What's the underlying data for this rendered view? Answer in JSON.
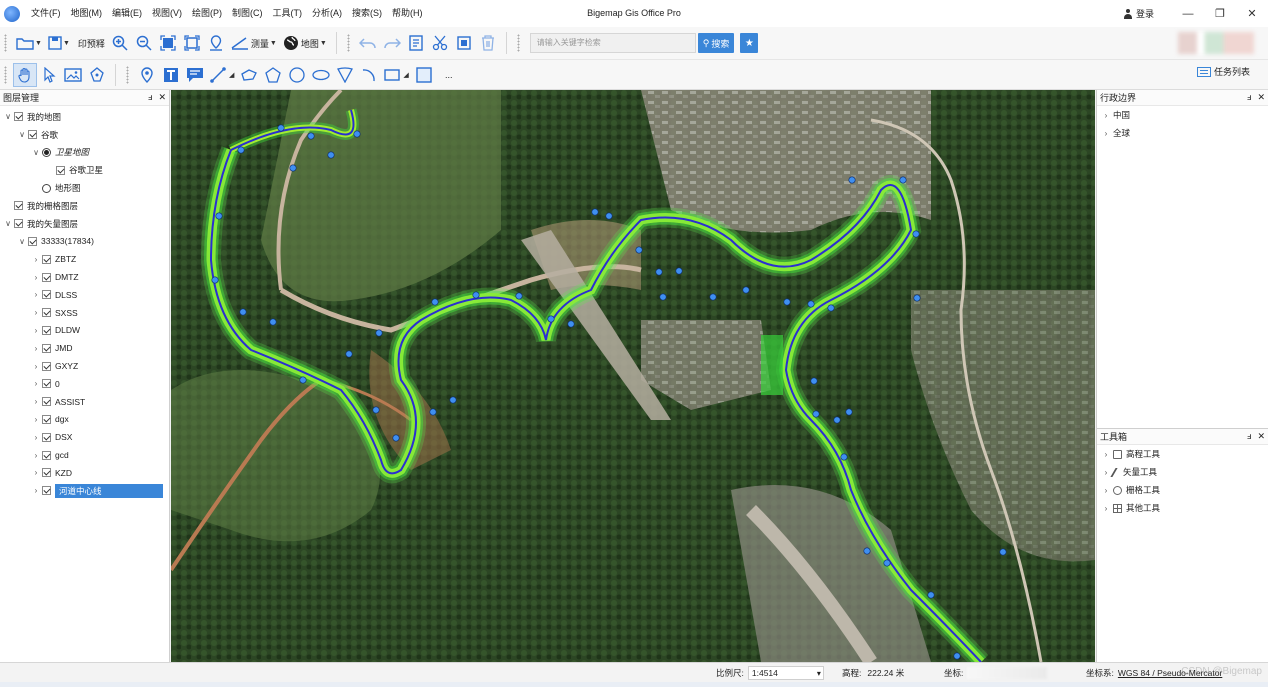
{
  "window": {
    "title": "Bigemap Gis Office Pro",
    "login_label": "登录",
    "minimize": "—",
    "maximize": "❐",
    "close": "✕"
  },
  "menu": [
    "文件(F)",
    "地图(M)",
    "编辑(E)",
    "视图(V)",
    "绘图(P)",
    "制图(C)",
    "工具(T)",
    "分析(A)",
    "搜索(S)",
    "帮助(H)"
  ],
  "toolbar1": {
    "print_label": "印预释",
    "measure_label": "测量",
    "map_label": "地图",
    "search_placeholder": "请输入关键字检索",
    "search_button": "搜索"
  },
  "toolbar2": {
    "more_label": "...",
    "task_list_label": "任务列表"
  },
  "layer_panel": {
    "title": "图层管理",
    "pin": "ⅎ",
    "close": "✕",
    "items": [
      {
        "label": "我的地图",
        "level": 0,
        "caret": "∨",
        "control": "check",
        "checked": true
      },
      {
        "label": "谷歌",
        "level": 1,
        "caret": "∨",
        "control": "check",
        "checked": true
      },
      {
        "label": "卫星地图",
        "level": 2,
        "caret": "∨",
        "control": "radio",
        "checked": true,
        "italic": true
      },
      {
        "label": "谷歌卫星",
        "level": 3,
        "caret": "",
        "control": "check",
        "checked": true
      },
      {
        "label": "地形图",
        "level": 2,
        "caret": "",
        "control": "radio",
        "checked": false
      },
      {
        "label": "我的栅格图层",
        "level": 0,
        "caret": "",
        "control": "check",
        "checked": true
      },
      {
        "label": "我的矢量图层",
        "level": 0,
        "caret": "∨",
        "control": "check",
        "checked": true
      },
      {
        "label": "33333(17834)",
        "level": 1,
        "caret": "∨",
        "control": "check",
        "checked": true
      },
      {
        "label": "ZBTZ",
        "level": 2,
        "caret": "›",
        "control": "check",
        "checked": true
      },
      {
        "label": "DMTZ",
        "level": 2,
        "caret": "›",
        "control": "check",
        "checked": true
      },
      {
        "label": "DLSS",
        "level": 2,
        "caret": "›",
        "control": "check",
        "checked": true
      },
      {
        "label": "SXSS",
        "level": 2,
        "caret": "›",
        "control": "check",
        "checked": true
      },
      {
        "label": "DLDW",
        "level": 2,
        "caret": "›",
        "control": "check",
        "checked": true
      },
      {
        "label": "JMD",
        "level": 2,
        "caret": "›",
        "control": "check",
        "checked": true
      },
      {
        "label": "GXYZ",
        "level": 2,
        "caret": "›",
        "control": "check",
        "checked": true
      },
      {
        "label": "0",
        "level": 2,
        "caret": "›",
        "control": "check",
        "checked": true
      },
      {
        "label": "ASSIST",
        "level": 2,
        "caret": "›",
        "control": "check",
        "checked": true
      },
      {
        "label": "dgx",
        "level": 2,
        "caret": "›",
        "control": "check",
        "checked": true
      },
      {
        "label": "DSX",
        "level": 2,
        "caret": "›",
        "control": "check",
        "checked": true
      },
      {
        "label": "gcd",
        "level": 2,
        "caret": "›",
        "control": "check",
        "checked": true
      },
      {
        "label": "KZD",
        "level": 2,
        "caret": "›",
        "control": "check",
        "checked": true
      },
      {
        "label": "河道中心线",
        "level": 2,
        "caret": "›",
        "control": "check",
        "checked": true,
        "selected": true
      }
    ]
  },
  "admin_panel": {
    "title": "行政边界",
    "pin": "ⅎ",
    "close": "✕",
    "items": [
      {
        "label": "中国",
        "caret": "›"
      },
      {
        "label": "全球",
        "caret": "›"
      }
    ]
  },
  "toolbox_panel": {
    "title": "工具箱",
    "pin": "ⅎ",
    "close": "✕",
    "items": [
      {
        "label": "高程工具",
        "caret": "›",
        "icon": "elevation-icon"
      },
      {
        "label": "矢量工具",
        "caret": "›",
        "icon": "pen-icon"
      },
      {
        "label": "栅格工具",
        "caret": "›",
        "icon": "grid-icon"
      },
      {
        "label": "其他工具",
        "caret": "›",
        "icon": "apps-icon"
      }
    ]
  },
  "status": {
    "scale_label": "比例尺:",
    "scale_value": "1:4514",
    "scale_arrow": "▾",
    "elevation_label": "高程:",
    "elevation_value": "222.24 米",
    "coords_label": "坐标:",
    "crs_label": "坐标系:",
    "crs_value": "WGS 84 / Pseudo-Mercator",
    "watermark": "CSDN @Bigemap"
  },
  "colors": {
    "accent": "#3a86d8",
    "centerline": "#2a2fd0",
    "contour_green": "#3fe63a",
    "contour_yellow": "#e6f02a",
    "point_blue": "#3f8ff0",
    "road": "#c9b9a8"
  }
}
